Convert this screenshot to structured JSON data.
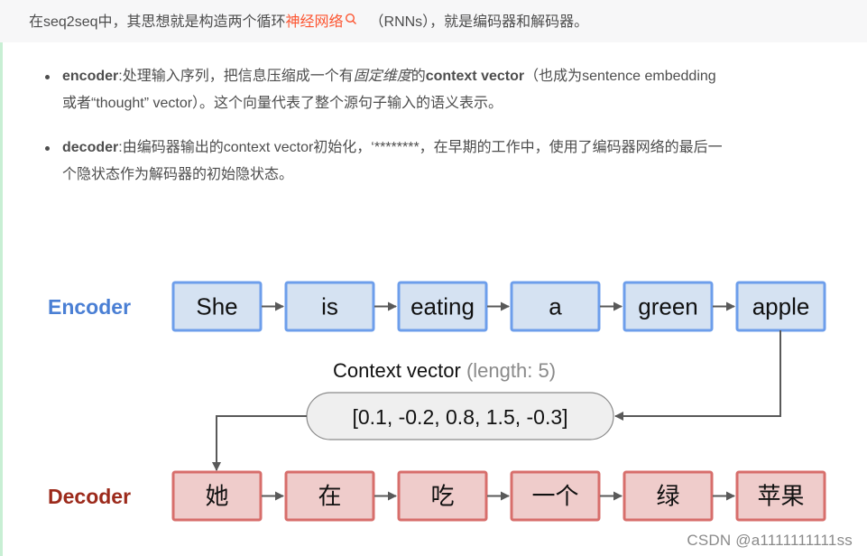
{
  "intro": {
    "prefix": "在seq2seq中，其思想就是构造两个循环",
    "link": "神经网络",
    "suffix": "（RNNs），就是编码器和解码器。"
  },
  "bullets": [
    {
      "term": "encoder",
      "line1_a": ":处理输入序列，把信息压缩成一个有",
      "line1_italic": "固定维度",
      "line1_b": "的",
      "line1_bold": "context vector",
      "line1_c": "（也成为sentence embedding",
      "line2": "或者“thought” vector）。这个向量代表了整个源句子输入的语义表示。"
    },
    {
      "term": "decoder",
      "line1": ":由编码器输出的context vector初始化，‘********，在早期的工作中，使用了编码器网络的最后一",
      "line2": "个隐状态作为解码器的初始隐状态。"
    }
  ],
  "diagram": {
    "encoder_label": "Encoder",
    "decoder_label": "Decoder",
    "encoder_tokens": [
      "She",
      "is",
      "eating",
      "a",
      "green",
      "apple"
    ],
    "decoder_tokens": [
      "她",
      "在",
      "吃",
      "一个",
      "绿",
      "苹果"
    ],
    "context_label": "Context vector",
    "context_length_note": "(length: 5)",
    "context_vector": "[0.1, -0.2, 0.8, 1.5, -0.3]",
    "colors": {
      "encoder_label": "#4a7fd4",
      "encoder_fill": "#d5e2f2",
      "encoder_border": "#6d9eeb",
      "decoder_label": "#9c2a1b",
      "decoder_fill": "#efcccb",
      "decoder_border": "#d76e6b",
      "arrow": "#595959",
      "pill_fill": "#efefef",
      "pill_border": "#8a8a8a"
    }
  },
  "watermark": "CSDN @a1111111111ss",
  "colors": {
    "link": "#fc5531",
    "text": "#4d4d4d",
    "stripe": "#c8efd4"
  }
}
